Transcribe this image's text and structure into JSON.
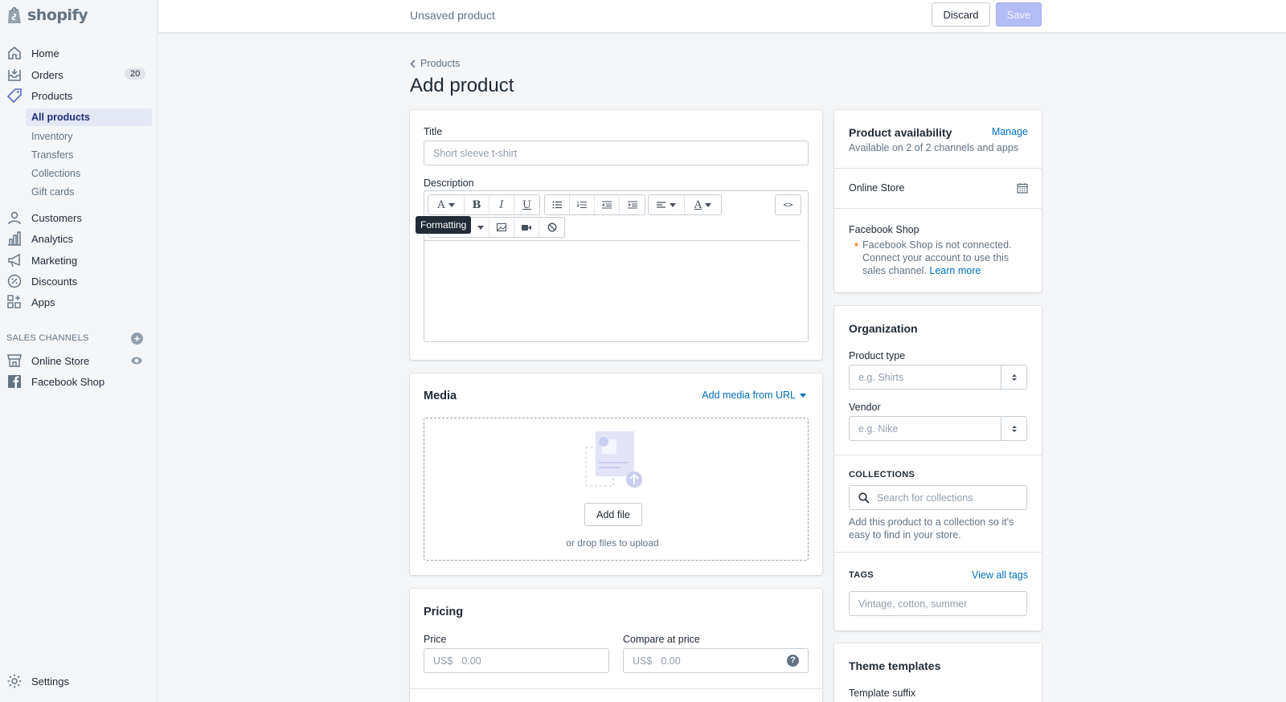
{
  "brand": {
    "name": "shopify"
  },
  "colors": {
    "accent": "#5c6ac4",
    "link": "#006fbb",
    "save_disabled": "#b3bcf5",
    "warning_dot": "#f49342"
  },
  "sidebar": {
    "nav": [
      {
        "label": "Home",
        "icon": "home-icon"
      },
      {
        "label": "Orders",
        "icon": "orders-icon",
        "badge": "20"
      },
      {
        "label": "Products",
        "icon": "tag-icon"
      }
    ],
    "products_sub": [
      "All products",
      "Inventory",
      "Transfers",
      "Collections",
      "Gift cards"
    ],
    "nav2": [
      {
        "label": "Customers",
        "icon": "person-icon"
      },
      {
        "label": "Analytics",
        "icon": "bar-chart-icon"
      },
      {
        "label": "Marketing",
        "icon": "megaphone-icon"
      },
      {
        "label": "Discounts",
        "icon": "discount-icon"
      },
      {
        "label": "Apps",
        "icon": "apps-icon"
      }
    ],
    "sales_channels_title": "SALES CHANNELS",
    "channels": [
      {
        "label": "Online Store",
        "icon": "store-icon"
      },
      {
        "label": "Facebook Shop",
        "icon": "facebook-icon"
      }
    ],
    "settings": "Settings"
  },
  "topbar": {
    "status": "Unsaved product",
    "discard": "Discard",
    "save": "Save"
  },
  "page": {
    "breadcrumb": "Products",
    "title": "Add product"
  },
  "product_card": {
    "title_label": "Title",
    "title_placeholder": "Short sleeve t-shirt",
    "description_label": "Description",
    "tooltip": "Formatting"
  },
  "media": {
    "heading": "Media",
    "add_url": "Add media from URL",
    "add_file": "Add file",
    "drop_text": "or drop files to upload"
  },
  "pricing": {
    "heading": "Pricing",
    "price_label": "Price",
    "compare_label": "Compare at price",
    "currency": "US$",
    "placeholder": "0.00"
  },
  "availability": {
    "heading": "Product availability",
    "manage": "Manage",
    "subtitle": "Available on 2 of 2 channels and apps",
    "online_store": "Online Store",
    "facebook_title": "Facebook Shop",
    "facebook_msg": "Facebook Shop is not connected. Connect your account to use this sales channel.",
    "learn_more": "Learn more"
  },
  "organization": {
    "heading": "Organization",
    "type_label": "Product type",
    "type_placeholder": "e.g. Shirts",
    "vendor_label": "Vendor",
    "vendor_placeholder": "e.g. Nike",
    "collections_title": "COLLECTIONS",
    "collections_placeholder": "Search for collections",
    "collections_help": "Add this product to a collection so it's easy to find in your store.",
    "tags_title": "TAGS",
    "view_tags": "View all tags",
    "tags_placeholder": "Vintage, cotton, summer"
  },
  "theme": {
    "heading": "Theme templates",
    "suffix_label": "Template suffix"
  }
}
